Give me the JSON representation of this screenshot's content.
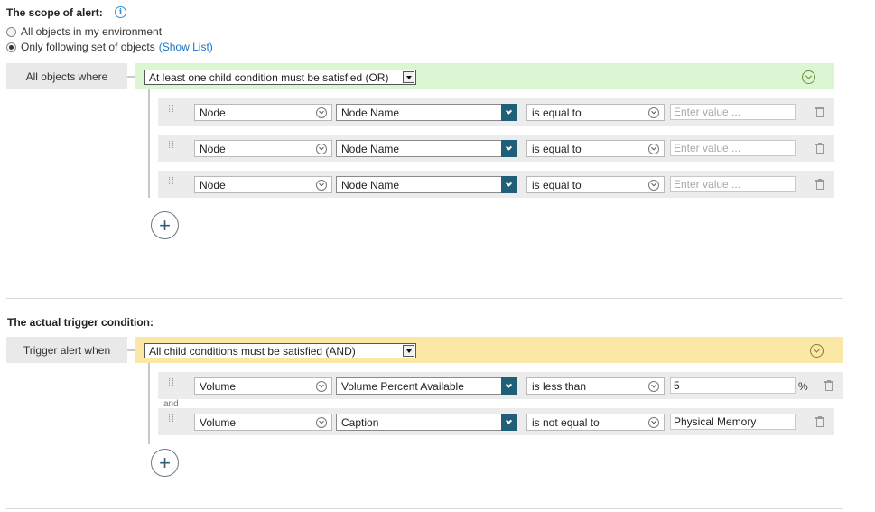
{
  "scope": {
    "title": "The scope of alert:",
    "info_icon": "info-icon",
    "option_all": "All objects in my environment",
    "option_following": "Only following set of objects",
    "show_list": "(Show List)"
  },
  "scope_group": {
    "label": "All objects where",
    "operator": "At least one child condition must be satisfied (OR)",
    "color": "#dcf5d2",
    "conditions": [
      {
        "object": "Node",
        "property": "Node Name",
        "comparison": "is equal to",
        "value_placeholder": "Enter value ..."
      },
      {
        "object": "Node",
        "property": "Node Name",
        "comparison": "is equal to",
        "value_placeholder": "Enter value ..."
      },
      {
        "object": "Node",
        "property": "Node Name",
        "comparison": "is equal to",
        "value_placeholder": "Enter value ..."
      }
    ]
  },
  "trigger": {
    "title": "The actual trigger condition:",
    "label": "Trigger alert when",
    "operator": "All child conditions must be satisfied (AND)",
    "color": "#fbe7a6",
    "joiner": "and",
    "conditions": [
      {
        "object": "Volume",
        "property": "Volume Percent Available",
        "comparison": "is less than",
        "value": "5",
        "unit": "%"
      },
      {
        "object": "Volume",
        "property": "Caption",
        "comparison": "is not equal to",
        "value": "Physical Memory"
      }
    ]
  }
}
